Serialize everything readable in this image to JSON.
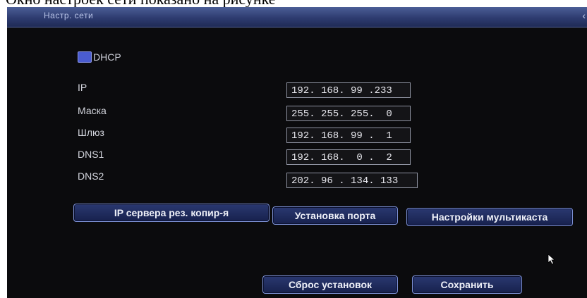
{
  "caption": "Окно настроек сети показано на рисунке",
  "window": {
    "title": "Настр. сети"
  },
  "dhcp": {
    "label": "DHCP",
    "checked": true
  },
  "fields": [
    {
      "label": "IP",
      "value": "192. 168. 99 .233"
    },
    {
      "label": "Маска",
      "value": "255. 255. 255.  0"
    },
    {
      "label": "Шлюз",
      "value": "192. 168. 99 .  1"
    },
    {
      "label": "DNS1",
      "value": "192. 168.  0 .  2"
    },
    {
      "label": "DNS2",
      "value": "202. 96 . 134. 133"
    }
  ],
  "buttons": {
    "backup_ip": "IP сервера рез. копир-я",
    "port": "Установка порта",
    "multicast": "Настройки мультикаста",
    "reset": "Сброс установок",
    "save": "Сохранить"
  },
  "colors": {
    "titlebar": "#2e3c70",
    "button_border": "#7f93d8",
    "checkbox": "#4a5cd0"
  }
}
